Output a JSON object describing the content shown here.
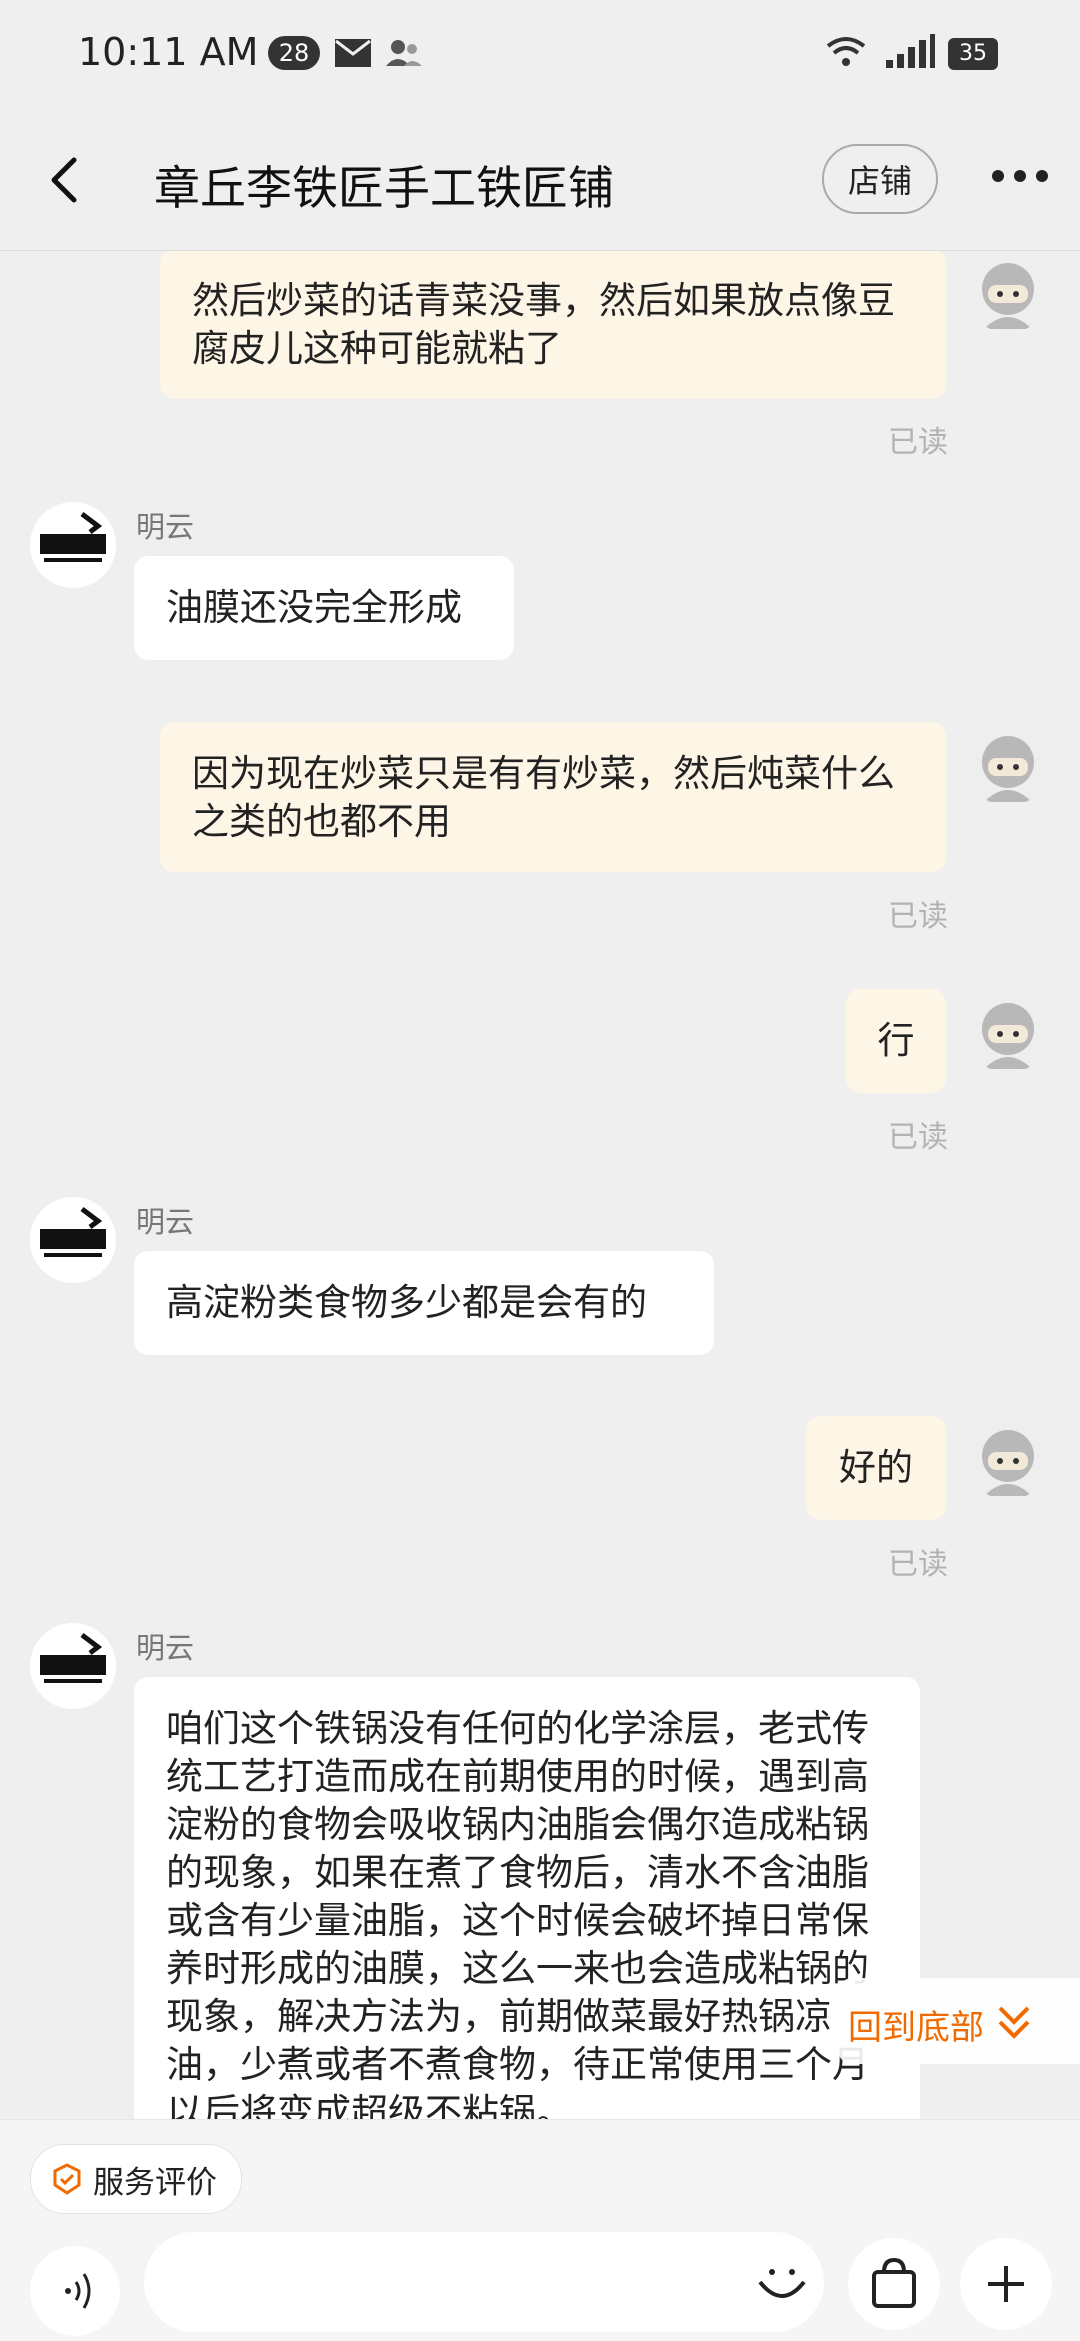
{
  "status_bar": {
    "time": "10:11 AM",
    "notification_count": "28",
    "battery": "35"
  },
  "header": {
    "title": "章丘李铁匠手工铁匠铺",
    "shop_button": "店铺"
  },
  "messages": [
    {
      "side": "right",
      "text": "然后炒菜的话青菜没事，然后如果放点像豆腐皮儿这种可能就粘了",
      "status": "已读"
    },
    {
      "side": "left",
      "sender": "明云",
      "text": "油膜还没完全形成"
    },
    {
      "side": "right",
      "text": "因为现在炒菜只是有有炒菜，然后炖菜什么之类的也都不用",
      "status": "已读"
    },
    {
      "side": "right",
      "text": "行",
      "status": "已读"
    },
    {
      "side": "left",
      "sender": "明云",
      "text": "高淀粉类食物多少都是会有的"
    },
    {
      "side": "right",
      "text": "好的",
      "status": "已读"
    },
    {
      "side": "left",
      "sender": "明云",
      "text": "咱们这个铁锅没有任何的化学涂层，老式传统工艺打造而成在前期使用的时候，遇到高淀粉的食物会吸收锅内油脂会偶尔造成粘锅的现象，如果在煮了食物后，清水不含油脂或含有少量油脂，这个时候会破坏掉日常保养时形成的油膜，这么一来也会造成粘锅的现象，解决方法为，前期做菜最好热锅凉油，少煮或者不煮食物，待正常使用三个月以后将变成超级不粘锅。"
    }
  ],
  "back_to_bottom": "回到底部",
  "bottom_bar": {
    "service_review": "服务评价"
  },
  "colors": {
    "accent": "#f06a00",
    "my_bubble": "#fdf6e6",
    "their_bubble": "#ffffff",
    "background": "#efefef"
  },
  "icons": [
    "back-arrow-icon",
    "more-icon",
    "voice-icon",
    "emoji-icon",
    "shopping-bag-icon",
    "plus-icon",
    "service-review-icon",
    "chevron-down-double-icon"
  ]
}
